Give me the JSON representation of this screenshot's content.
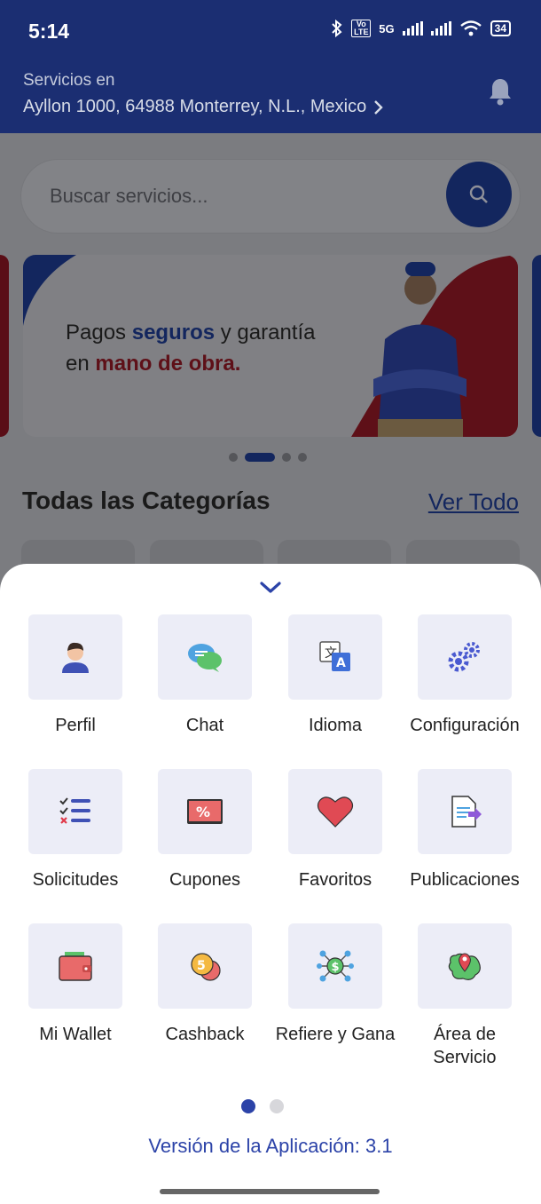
{
  "status": {
    "time": "5:14",
    "network": "5G",
    "volte": "Vo LTE",
    "battery": "34"
  },
  "header": {
    "label": "Servicios en",
    "address": "Ayllon 1000, 64988 Monterrey, N.L., Mexico"
  },
  "search": {
    "placeholder": "Buscar servicios..."
  },
  "banner": {
    "line1_a": "Pagos ",
    "line1_b": "seguros",
    "line1_c": " y garantía",
    "line2_a": "en ",
    "line2_b": "mano de obra."
  },
  "categories": {
    "title": "Todas las Categorías",
    "see_all": "Ver Todo"
  },
  "menu": {
    "items": [
      {
        "label": "Perfil",
        "icon": "profile-icon"
      },
      {
        "label": "Chat",
        "icon": "chat-icon"
      },
      {
        "label": "Idioma",
        "icon": "language-icon"
      },
      {
        "label": "Configuración",
        "icon": "settings-gears-icon"
      },
      {
        "label": "Solicitudes",
        "icon": "checklist-icon"
      },
      {
        "label": "Cupones",
        "icon": "coupon-icon"
      },
      {
        "label": "Favoritos",
        "icon": "heart-icon"
      },
      {
        "label": "Publicaciones",
        "icon": "document-icon"
      },
      {
        "label": "Mi Wallet",
        "icon": "wallet-icon"
      },
      {
        "label": "Cashback",
        "icon": "coins-icon"
      },
      {
        "label": "Refiere y Gana",
        "icon": "referral-network-icon"
      },
      {
        "label": "Área de Servicio",
        "icon": "map-pin-icon"
      }
    ],
    "page": 1,
    "pages": 2
  },
  "version": "Versión de la Aplicación: 3.1",
  "colors": {
    "primary": "#1b2e72",
    "accent_blue": "#2c43a8",
    "accent_red": "#d32f3a",
    "tile_bg": "#ecedf7"
  }
}
